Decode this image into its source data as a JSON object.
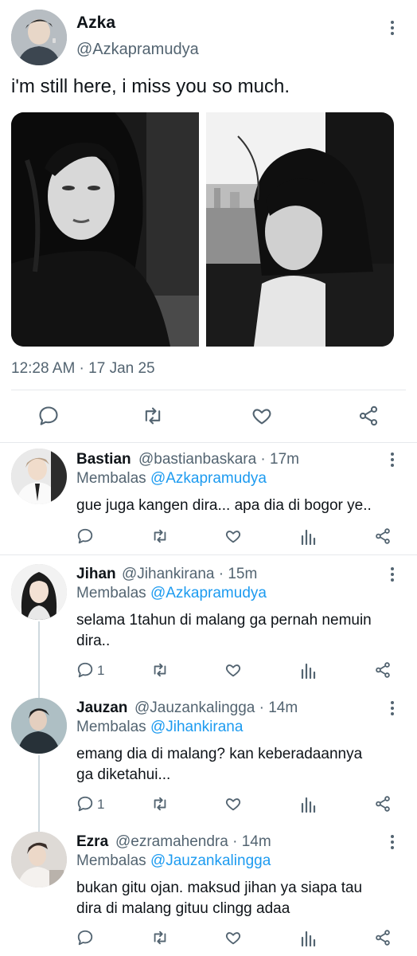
{
  "tweet": {
    "author_name": "Azka",
    "author_handle": "@Azkapramudya",
    "text": "i'm still here, i miss you so much.",
    "timestamp": "12:28 AM · 17 Jan 25"
  },
  "replies": [
    {
      "name": "Bastian",
      "handle_time": "@bastianbaskara · 17m",
      "replying_prefix": "Membalas",
      "replying_to": "@Azkapramudya",
      "text": "gue juga kangen dira... apa dia di bogor ye..",
      "reply_count": ""
    },
    {
      "name": "Jihan",
      "handle_time": "@Jihankirana · 15m",
      "replying_prefix": "Membalas",
      "replying_to": "@Azkapramudya",
      "text_line1": "selama 1tahun di malang ga pernah nemuin",
      "text_line2": "dira..",
      "reply_count": "1"
    },
    {
      "name": "Jauzan",
      "handle_time": "@Jauzankalingga · 14m",
      "replying_prefix": "Membalas",
      "replying_to": "@Jihankirana",
      "text_line1": "emang dia di malang? kan keberadaannya",
      "text_line2": "ga diketahui...",
      "reply_count": "1"
    },
    {
      "name": "Ezra",
      "handle_time": "@ezramahendra · 14m",
      "replying_prefix": "Membalas",
      "replying_to": "@Jauzankalingga",
      "text_line1": "bukan gitu ojan. maksud jihan ya siapa tau",
      "text_line2": "dira di malang gituu clingg adaa",
      "reply_count": ""
    }
  ],
  "colors": {
    "accent": "#1d9bf0",
    "muted": "#536471",
    "text": "#0f1419"
  },
  "icons": [
    "reply-icon",
    "retweet-icon",
    "like-icon",
    "share-icon",
    "views-icon",
    "more-icon"
  ]
}
